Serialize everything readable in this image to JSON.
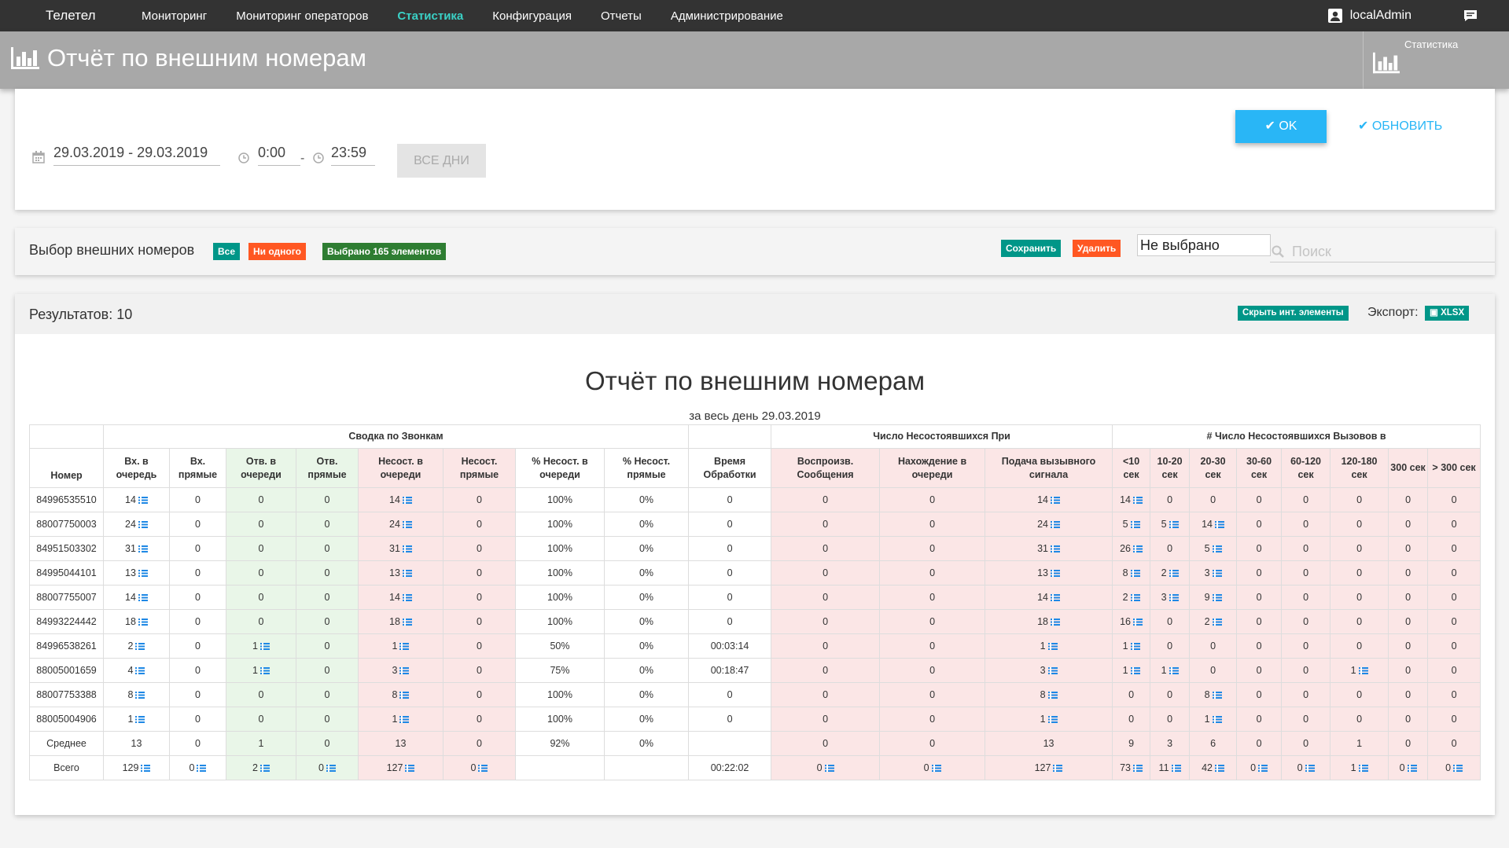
{
  "nav": {
    "brand": "Телетел",
    "items": [
      "Мониторинг",
      "Мониторинг операторов",
      "Статистика",
      "Конфигурация",
      "Отчеты",
      "Администрирование"
    ],
    "active_index": 2,
    "user": "localAdmin"
  },
  "header": {
    "title": "Отчёт по внешним номерам",
    "section_label": "Статистика"
  },
  "filter": {
    "date_range": "29.03.2019 - 29.03.2019",
    "time_from": "0:00",
    "time_sep": "-",
    "time_to": "23:59",
    "all_days_label": "ВСЕ ДНИ",
    "ok_label": "OK",
    "refresh_label": "ОБНОВИТЬ"
  },
  "selection": {
    "title": "Выбор внешних номеров",
    "all_label": "Все",
    "none_label": "Ни одного",
    "selected_label": "Выбрано 165 элементов",
    "save_label": "Сохранить",
    "delete_label": "Удалить",
    "preset_value": "Не выбрано",
    "search_placeholder": "Поиск"
  },
  "results": {
    "count_label": "Результатов: 10",
    "hide_label": "Скрыть инт. элементы",
    "export_label": "Экспорт:",
    "xlsx_label": "XLSX",
    "report_title": "Отчёт по внешним номерам",
    "report_subtitle": "за весь день 29.03.2019"
  },
  "table": {
    "groups": [
      "Сводка по Звонкам",
      "Число Несостоявшихся При",
      "# Число Несостоявшихся Вызовов в"
    ],
    "columns": [
      "Номер",
      "Вх. в очередь",
      "Вх. прямые",
      "Отв. в очереди",
      "Отв. прямые",
      "Несост. в очереди",
      "Несост. прямые",
      "% Несост. в очереди",
      "% Несост. прямые",
      "Время Обработки",
      "Воспроизв. Сообщения",
      "Нахождение в очереди",
      "Подача вызывного сигнала",
      "<10 сек",
      "10-20 сек",
      "20-30 сек",
      "30-60 сек",
      "60-120 сек",
      "120-180 сек",
      "300 сек",
      "> 300 сек"
    ],
    "rows": [
      [
        "84996535510",
        "14",
        "0",
        "0",
        "0",
        "14",
        "0",
        "100%",
        "0%",
        "0",
        "0",
        "0",
        "14",
        "14",
        "0",
        "0",
        "0",
        "0",
        "0",
        "0",
        "0"
      ],
      [
        "88007750003",
        "24",
        "0",
        "0",
        "0",
        "24",
        "0",
        "100%",
        "0%",
        "0",
        "0",
        "0",
        "24",
        "5",
        "5",
        "14",
        "0",
        "0",
        "0",
        "0",
        "0"
      ],
      [
        "84951503302",
        "31",
        "0",
        "0",
        "0",
        "31",
        "0",
        "100%",
        "0%",
        "0",
        "0",
        "0",
        "31",
        "26",
        "0",
        "5",
        "0",
        "0",
        "0",
        "0",
        "0"
      ],
      [
        "84995044101",
        "13",
        "0",
        "0",
        "0",
        "13",
        "0",
        "100%",
        "0%",
        "0",
        "0",
        "0",
        "13",
        "8",
        "2",
        "3",
        "0",
        "0",
        "0",
        "0",
        "0"
      ],
      [
        "88007755007",
        "14",
        "0",
        "0",
        "0",
        "14",
        "0",
        "100%",
        "0%",
        "0",
        "0",
        "0",
        "14",
        "2",
        "3",
        "9",
        "0",
        "0",
        "0",
        "0",
        "0"
      ],
      [
        "84993224442",
        "18",
        "0",
        "0",
        "0",
        "18",
        "0",
        "100%",
        "0%",
        "0",
        "0",
        "0",
        "18",
        "16",
        "0",
        "2",
        "0",
        "0",
        "0",
        "0",
        "0"
      ],
      [
        "84996538261",
        "2",
        "0",
        "1",
        "0",
        "1",
        "0",
        "50%",
        "0%",
        "00:03:14",
        "0",
        "0",
        "1",
        "1",
        "0",
        "0",
        "0",
        "0",
        "0",
        "0",
        "0"
      ],
      [
        "88005001659",
        "4",
        "0",
        "1",
        "0",
        "3",
        "0",
        "75%",
        "0%",
        "00:18:47",
        "0",
        "0",
        "3",
        "1",
        "1",
        "0",
        "0",
        "0",
        "1",
        "0",
        "0"
      ],
      [
        "88007753388",
        "8",
        "0",
        "0",
        "0",
        "8",
        "0",
        "100%",
        "0%",
        "0",
        "0",
        "0",
        "8",
        "0",
        "0",
        "8",
        "0",
        "0",
        "0",
        "0",
        "0"
      ],
      [
        "88005004906",
        "1",
        "0",
        "0",
        "0",
        "1",
        "0",
        "100%",
        "0%",
        "0",
        "0",
        "0",
        "1",
        "0",
        "0",
        "1",
        "0",
        "0",
        "0",
        "0",
        "0"
      ],
      [
        "Среднее",
        "13",
        "0",
        "1",
        "0",
        "13",
        "0",
        "92%",
        "0%",
        "",
        "0",
        "0",
        "13",
        "9",
        "3",
        "6",
        "0",
        "0",
        "1",
        "0",
        "0"
      ],
      [
        "Всего",
        "129",
        "0",
        "2",
        "0",
        "127",
        "0",
        "",
        "",
        "00:22:02",
        "0",
        "0",
        "127",
        "73",
        "11",
        "42",
        "0",
        "0",
        "1",
        "0",
        "0"
      ]
    ],
    "icon_cells": [
      [
        1,
        5,
        12,
        13
      ],
      [
        1,
        5,
        12,
        13,
        14,
        15
      ],
      [
        1,
        5,
        12,
        13,
        15
      ],
      [
        1,
        5,
        12,
        13,
        14,
        15
      ],
      [
        1,
        5,
        12,
        13,
        14,
        15
      ],
      [
        1,
        5,
        12,
        13,
        15
      ],
      [
        1,
        3,
        5,
        12,
        13
      ],
      [
        1,
        3,
        5,
        12,
        13,
        14,
        18
      ],
      [
        1,
        5,
        12,
        15
      ],
      [
        1,
        5,
        12,
        15
      ],
      [],
      [
        1,
        2,
        3,
        4,
        5,
        6,
        10,
        11,
        12,
        13,
        14,
        15,
        16,
        17,
        18,
        19,
        20
      ]
    ]
  },
  "colors": {
    "accent": "#29b6f6",
    "nav_active": "#3ad1c6",
    "green_cell": "#e9f6e8",
    "red_cell": "#fbe6e6"
  }
}
